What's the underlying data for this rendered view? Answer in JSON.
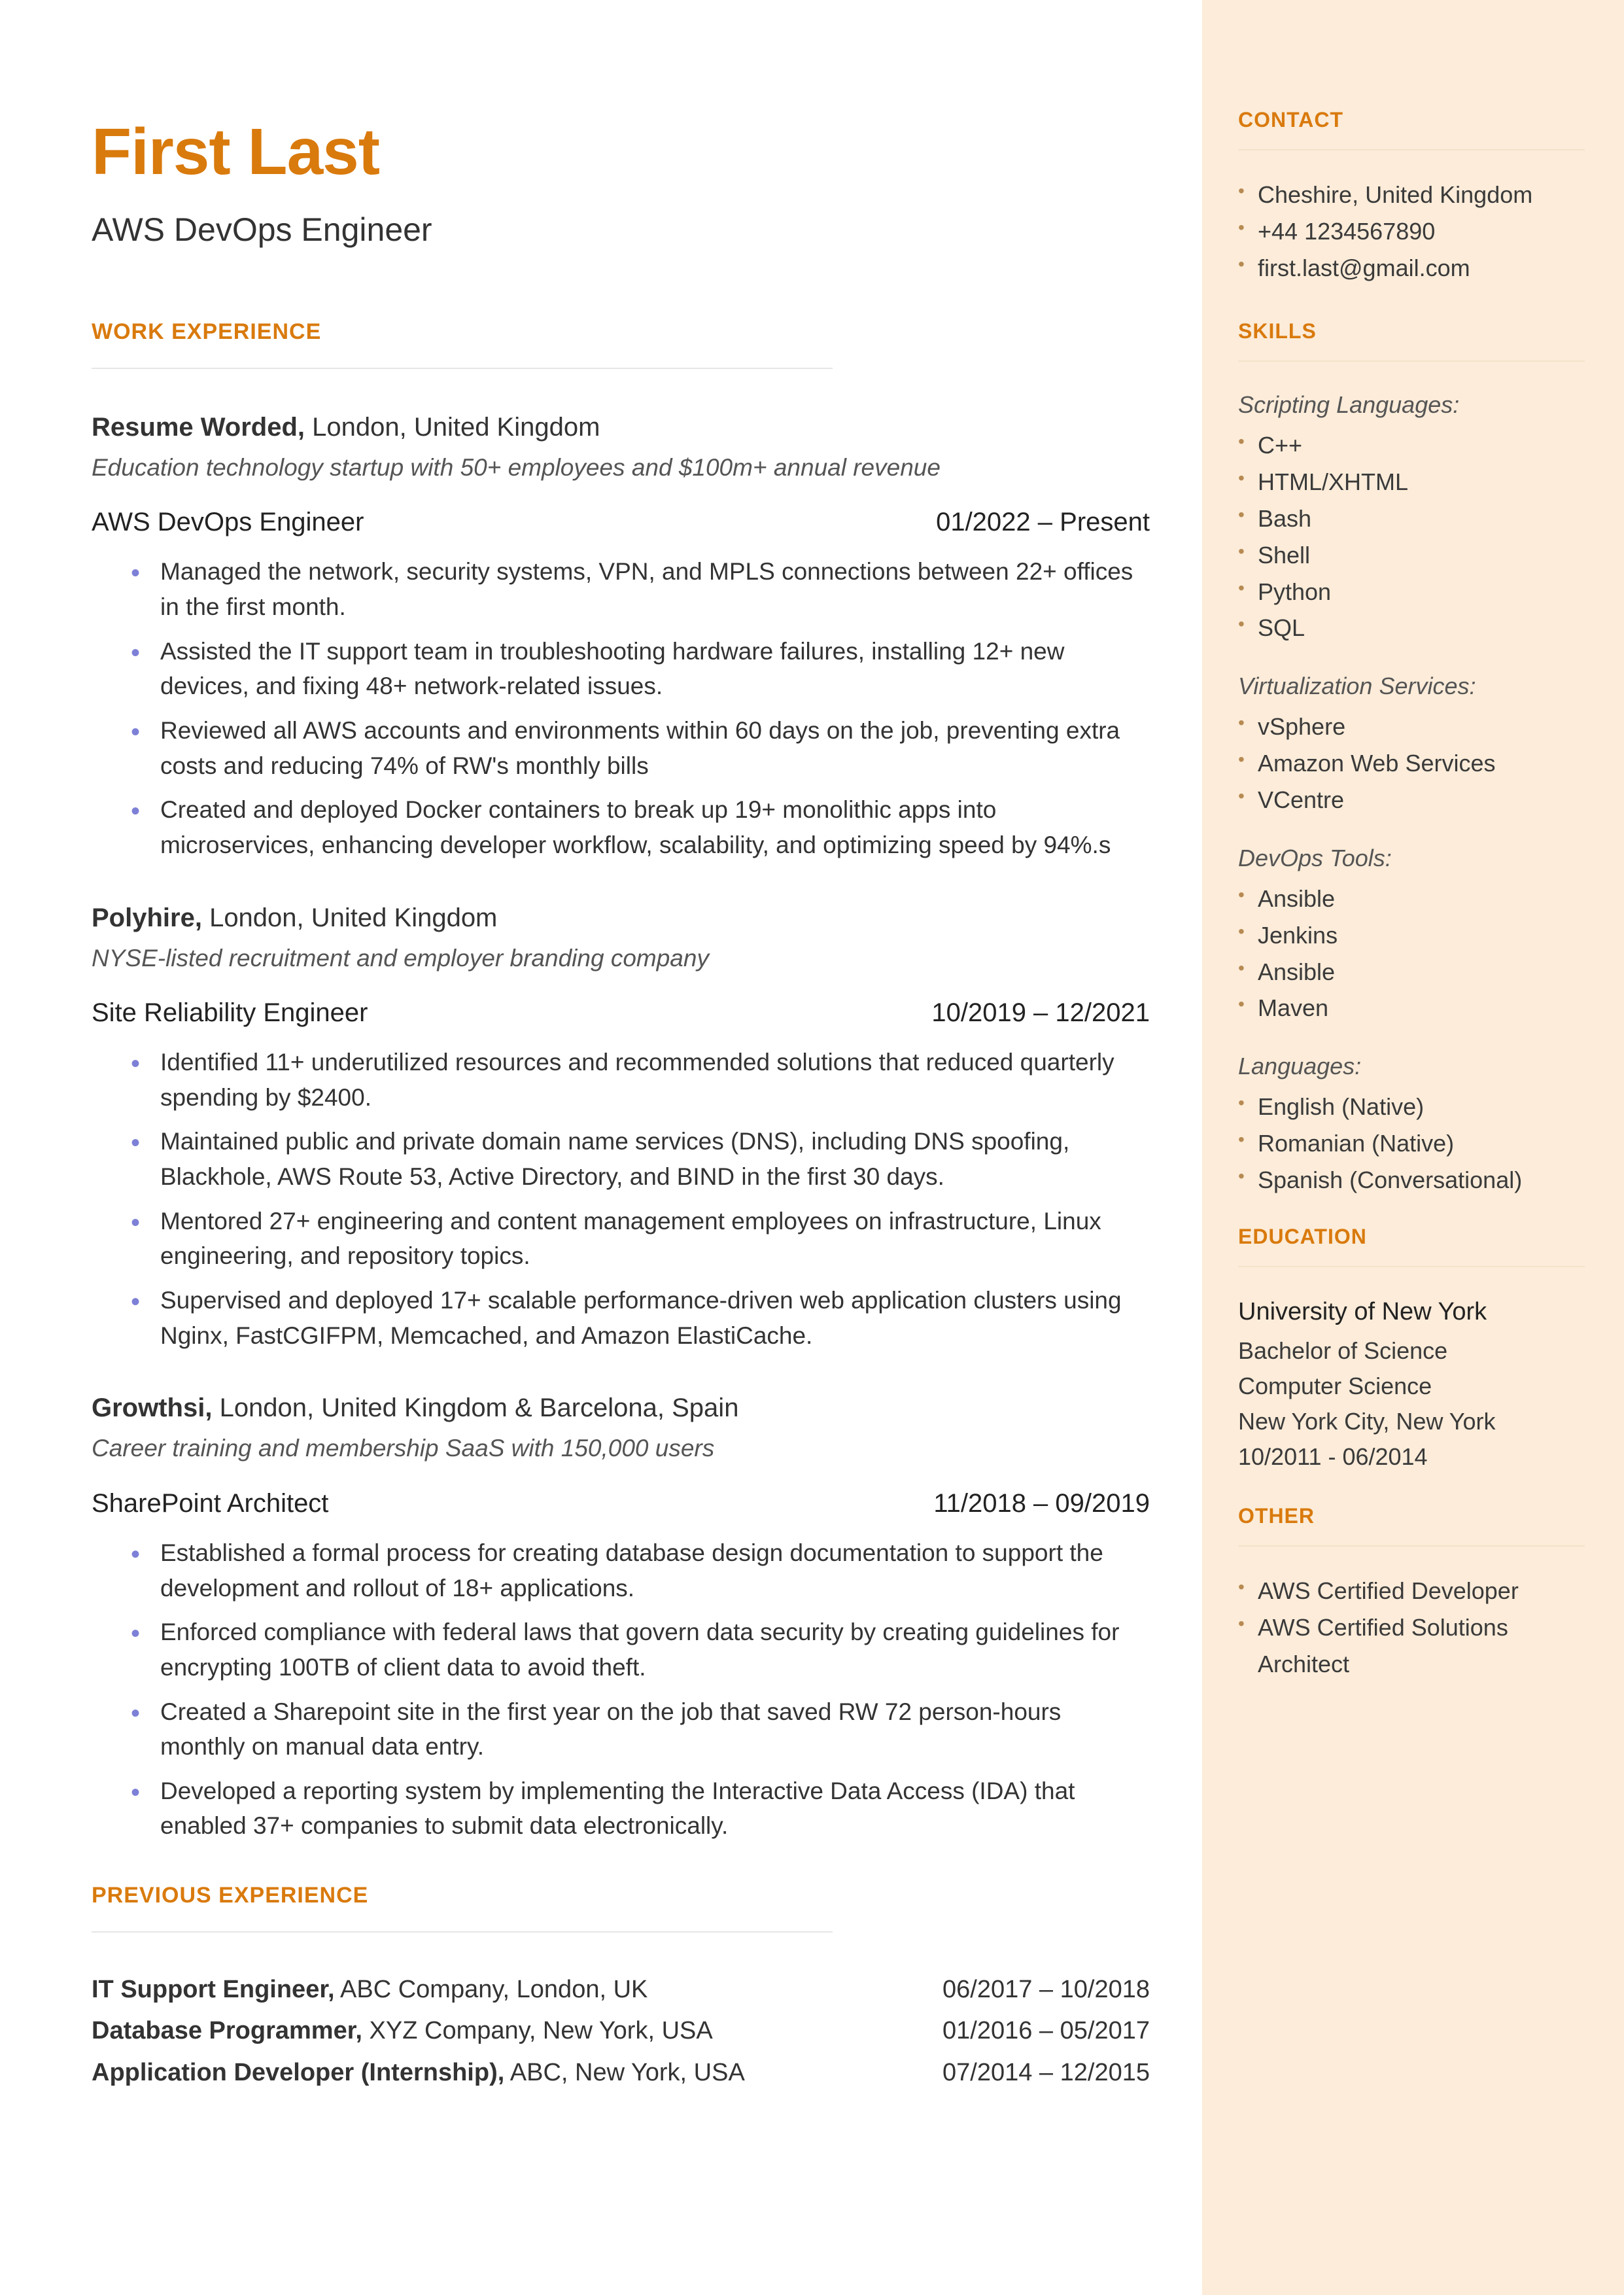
{
  "header": {
    "name": "First Last",
    "title": "AWS DevOps Engineer"
  },
  "sections": {
    "work": "WORK EXPERIENCE",
    "previous": "PREVIOUS EXPERIENCE",
    "contact": "CONTACT",
    "skills": "SKILLS",
    "education": "EDUCATION",
    "other": "OTHER"
  },
  "jobs": [
    {
      "company": "Resume Worded,",
      "location": " London, United Kingdom",
      "desc": "Education technology startup with 50+ employees and $100m+ annual revenue",
      "role": "AWS DevOps Engineer",
      "dates": "01/2022 – Present",
      "bullets": [
        "Managed the network, security systems, VPN, and MPLS connections between 22+ offices in the first month.",
        "Assisted the IT support team in troubleshooting hardware failures, installing 12+ new devices, and fixing 48+ network-related issues.",
        "Reviewed all AWS accounts and environments within 60 days on the job, preventing extra costs and reducing 74% of RW's monthly bills",
        "Created and deployed Docker containers to break up 19+ monolithic apps into microservices, enhancing developer workflow, scalability, and optimizing speed by 94%.s"
      ]
    },
    {
      "company": "Polyhire,",
      "location": " London, United Kingdom",
      "desc": "NYSE-listed recruitment and employer branding company",
      "role": "Site Reliability Engineer",
      "dates": "10/2019 – 12/2021",
      "bullets": [
        "Identified 11+ underutilized resources and recommended solutions that reduced quarterly spending by $2400.",
        "Maintained public and private domain name services (DNS), including DNS spoofing, Blackhole, AWS Route 53, Active Directory, and BIND in the first 30 days.",
        "Mentored 27+ engineering and content management employees on infrastructure, Linux engineering, and repository topics.",
        "Supervised and deployed 17+ scalable performance-driven web application clusters using Nginx, FastCGIFPM, Memcached, and Amazon ElastiCache."
      ]
    },
    {
      "company": "Growthsi,",
      "location": " London, United Kingdom & Barcelona, Spain",
      "desc": "Career training and membership SaaS with 150,000 users",
      "role": "SharePoint Architect",
      "dates": "11/2018 – 09/2019",
      "bullets": [
        "Established a formal process for creating database design documentation to support the development and rollout of 18+ applications.",
        "Enforced compliance with federal laws that govern data security by creating guidelines for encrypting 100TB of client data to avoid theft.",
        "Created a Sharepoint site in the first year on the job that saved RW 72 person-hours monthly on manual data entry.",
        "Developed a reporting system by implementing the Interactive Data Access (IDA) that enabled 37+ companies to submit data electronically."
      ]
    }
  ],
  "previous": [
    {
      "role": "IT Support Engineer,",
      "loc": " ABC Company, London, UK",
      "dates": "06/2017 – 10/2018"
    },
    {
      "role": "Database Programmer,",
      "loc": " XYZ Company, New York, USA",
      "dates": "01/2016 – 05/2017"
    },
    {
      "role": "Application Developer (Internship),",
      "loc": " ABC, New York, USA",
      "dates": "07/2014 – 12/2015"
    }
  ],
  "contact": [
    "Cheshire, United Kingdom",
    "+44 1234567890",
    "first.last@gmail.com"
  ],
  "skills": {
    "groups": [
      {
        "label": "Scripting Languages:",
        "items": [
          "C++",
          "HTML/XHTML",
          "Bash",
          "Shell",
          "Python",
          "SQL"
        ]
      },
      {
        "label": "Virtualization Services:",
        "items": [
          "vSphere",
          "Amazon Web Services",
          "VCentre"
        ]
      },
      {
        "label": "DevOps Tools:",
        "items": [
          "Ansible",
          "Jenkins",
          "Ansible",
          "Maven"
        ]
      },
      {
        "label": "Languages:",
        "items": [
          "English (Native)",
          "Romanian (Native)",
          "Spanish (Conversational)"
        ]
      }
    ]
  },
  "education": {
    "school": "University of New York",
    "degree": "Bachelor of Science",
    "major": "Computer Science",
    "location": "New York City, New York",
    "dates": "10/2011 - 06/2014"
  },
  "other": [
    "AWS Certified Developer",
    "AWS Certified Solutions Architect"
  ]
}
